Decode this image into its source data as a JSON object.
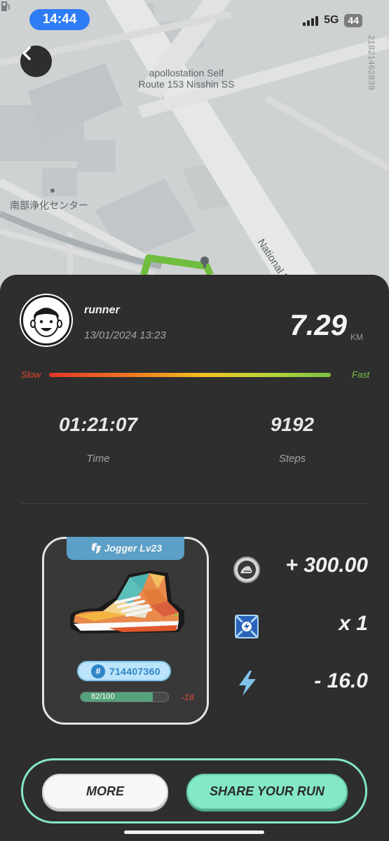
{
  "status_bar": {
    "time": "14:44",
    "network": "5G",
    "battery": "44"
  },
  "map": {
    "side_id": "21821462839",
    "gas_station_line1": "apollostation Self",
    "gas_station_line2": "Route 153 Nisshin SS",
    "facility": "南部浄化センター",
    "road": "National R"
  },
  "run": {
    "username": "runner",
    "date": "13/01/2024 13:23",
    "distance": "7.29",
    "distance_unit": "KM",
    "slow_label": "Slow",
    "fast_label": "Fast",
    "time_value": "01:21:07",
    "time_label": "Time",
    "steps_value": "9192",
    "steps_label": "Steps"
  },
  "shoe": {
    "tag": "Jogger Lv23",
    "id": "714407360",
    "durability_text": "82/100",
    "durability_fraction": 0.82,
    "durability_change": "-18"
  },
  "rewards": {
    "token": "+ 300.00",
    "mystery": "x 1",
    "energy": "- 16.0"
  },
  "buttons": {
    "more": "MORE",
    "share": "SHARE YOUR RUN"
  },
  "colors": {
    "accent": "#84e8c4",
    "route": "#6fbe3e",
    "badge": "#5ca0c7"
  }
}
